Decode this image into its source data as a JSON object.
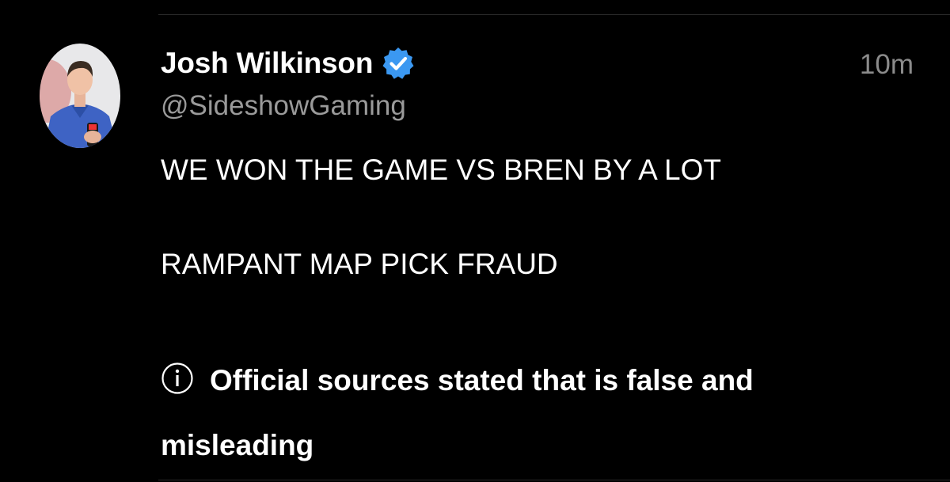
{
  "tweet": {
    "display_name": "Josh Wilkinson",
    "handle": "@SideshowGaming",
    "timestamp": "10m",
    "verified": true,
    "verified_icon": "verified-badge-icon",
    "verified_color": "#3b98f1",
    "body_lines": [
      "WE WON THE GAME VS BREN BY A LOT",
      "RAMPANT MAP PICK FRAUD"
    ]
  },
  "notice": {
    "icon": "info-icon",
    "text": "Official sources stated that is false and misleading"
  },
  "colors": {
    "background": "#000000",
    "text_primary": "#ffffff",
    "text_secondary": "#9a9a9a"
  }
}
